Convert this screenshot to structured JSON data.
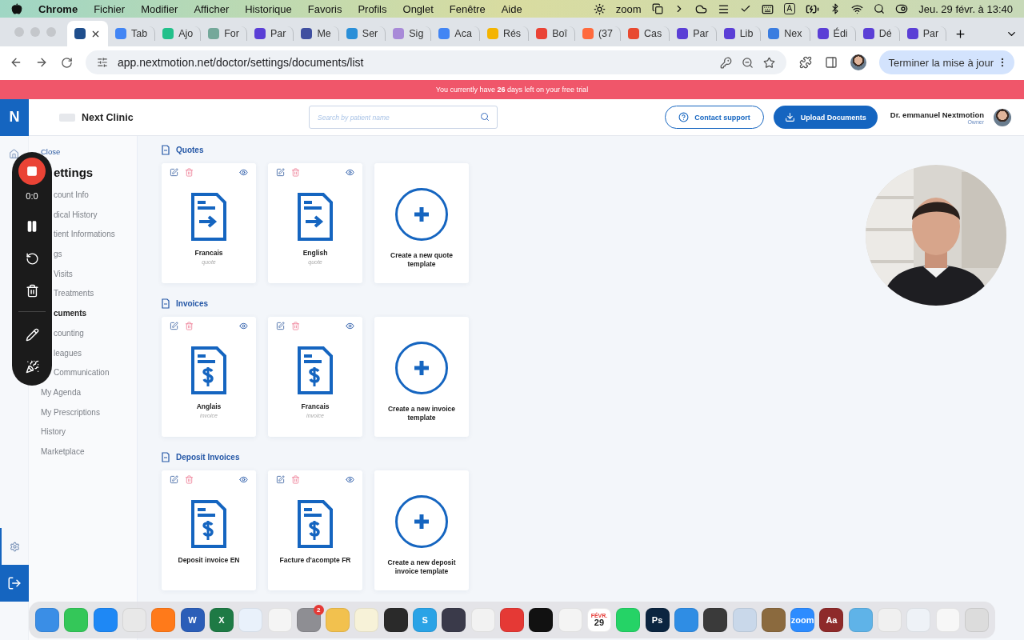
{
  "menubar": {
    "app": "Chrome",
    "menus": [
      "Fichier",
      "Modifier",
      "Afficher",
      "Historique",
      "Favoris",
      "Profils",
      "Onglet",
      "Fenêtre",
      "Aide"
    ],
    "zoom_label": "zoom",
    "input_source": "A",
    "clock": "Jeu. 29 févr. à 13:40"
  },
  "tabs": [
    {
      "selected": true,
      "color": "#1f4e8c"
    },
    {
      "label": "Tab",
      "selected": false,
      "color": "#4285f4"
    },
    {
      "label": "Ajo",
      "selected": false,
      "color": "#22c08a"
    },
    {
      "label": "For",
      "selected": false,
      "color": "#74a89a"
    },
    {
      "label": "Par",
      "selected": false,
      "color": "#5b3fd6"
    },
    {
      "label": "Me",
      "selected": false,
      "color": "#3f4fa0"
    },
    {
      "label": "Ser",
      "selected": false,
      "color": "#2a8fd8"
    },
    {
      "label": "Sig",
      "selected": false,
      "color": "#a88ad8"
    },
    {
      "label": "Aca",
      "selected": false,
      "color": "#4285f4"
    },
    {
      "label": "Rés",
      "selected": false,
      "color": "#f4b400"
    },
    {
      "label": "Boî",
      "selected": false,
      "color": "#ea4335"
    },
    {
      "label": "(37",
      "selected": false,
      "color": "#ff6a3d"
    },
    {
      "label": "Cas",
      "selected": false,
      "color": "#e8492f"
    },
    {
      "label": "Par",
      "selected": false,
      "color": "#5b3fd6"
    },
    {
      "label": "Lib",
      "selected": false,
      "color": "#5b3fd6"
    },
    {
      "label": "Nex",
      "selected": false,
      "color": "#3b7de0"
    },
    {
      "label": "Édi",
      "selected": false,
      "color": "#5b3fd6"
    },
    {
      "label": "Dé",
      "selected": false,
      "color": "#5b3fd6"
    },
    {
      "label": "Par",
      "selected": false,
      "color": "#5b3fd6"
    }
  ],
  "address_bar": {
    "url": "app.nextmotion.net/doctor/settings/documents/list",
    "update_button": "Terminer la mise à jour"
  },
  "banner": {
    "text": "You currently have **26** days left on your free trial"
  },
  "header": {
    "logo": "N",
    "clinic": "Next Clinic",
    "search": {
      "placeholder": "Search by patient name"
    },
    "contact_button": "Contact support",
    "upload_button": "Upload Documents",
    "user": {
      "name": "Dr. emmanuel Nextmotion",
      "role": "Owner"
    }
  },
  "sidebar": {
    "close": "Close",
    "title": "ettings",
    "items": [
      {
        "label": "count Info",
        "selected": false,
        "kind": "partial"
      },
      {
        "label": "dical History",
        "selected": false,
        "kind": "partial"
      },
      {
        "label": "tient Informations",
        "selected": false,
        "kind": "partial"
      },
      {
        "label": "gs",
        "selected": false,
        "kind": "partial"
      },
      {
        "label": "Visits",
        "selected": false,
        "kind": "partial"
      },
      {
        "label": "Treatments",
        "selected": false,
        "kind": "partial"
      },
      {
        "label": "cuments",
        "selected": true,
        "kind": "partial"
      },
      {
        "label": "counting",
        "selected": false,
        "kind": "partial"
      },
      {
        "label": "leagues",
        "selected": false,
        "kind": "partial"
      },
      {
        "label": "Communication",
        "selected": false,
        "kind": "partial"
      },
      {
        "label": "My Agenda",
        "selected": false
      },
      {
        "label": "My Prescriptions",
        "selected": false
      },
      {
        "label": "History",
        "selected": false
      },
      {
        "label": "Marketplace",
        "selected": false
      }
    ]
  },
  "sections": [
    {
      "title": "Quotes",
      "kind": "quote",
      "templates": [
        {
          "name": "Francais",
          "type": "quote"
        },
        {
          "name": "English",
          "type": "quote"
        }
      ],
      "create": "Create a new quote template"
    },
    {
      "title": "Invoices",
      "kind": "invoice",
      "templates": [
        {
          "name": "Anglais",
          "type": "invoice"
        },
        {
          "name": "Francais",
          "type": "invoice"
        }
      ],
      "create": "Create a new invoice template"
    },
    {
      "title": "Deposit Invoices",
      "kind": "invoice",
      "templates": [
        {
          "name": "Deposit invoice EN"
        },
        {
          "name": "Facture d'acompte FR"
        }
      ],
      "create": "Create a new deposit invoice template"
    }
  ],
  "recorder": {
    "timer": "0:0"
  },
  "dock": {
    "items": [
      {
        "color": "#3a8ee6"
      },
      {
        "color": "#34c759"
      },
      {
        "color": "#1e88f5"
      },
      {
        "color": "#e8e8e8"
      },
      {
        "color": "#ff7a1a"
      },
      {
        "color": "#2b5eb8",
        "label": "W"
      },
      {
        "color": "#1e7a45",
        "label": "X"
      },
      {
        "color": "#e9f1fb"
      },
      {
        "color": "#f5f5f5"
      },
      {
        "color": "#8e8e93",
        "badge": "2"
      },
      {
        "color": "#f2c14e"
      },
      {
        "color": "#f7f2d8"
      },
      {
        "color": "#2a2a2a"
      },
      {
        "color": "#2aa3e6",
        "label": "S"
      },
      {
        "color": "#3a3a4a"
      },
      {
        "color": "#f2f2f2"
      },
      {
        "color": "#e53935"
      },
      {
        "color": "#111111"
      },
      {
        "color": "#f4f4f4"
      },
      {
        "color": "#ffffff",
        "label": "29",
        "caption": "FÉVR."
      },
      {
        "color": "#25d366"
      },
      {
        "color": "#0b2540",
        "label": "Ps"
      },
      {
        "color": "#2f8de4"
      },
      {
        "color": "#3a3a3a"
      },
      {
        "color": "#c9d8ea"
      },
      {
        "color": "#8b6a3e"
      },
      {
        "color": "#2d8cff",
        "label": "zoom"
      },
      {
        "color": "#8e2a2a",
        "label": "Aa"
      },
      {
        "color": "#5fb3e8"
      },
      {
        "color": "#f0f0f0"
      },
      {
        "color": "#eef2f7"
      },
      {
        "color": "#f7f7f7"
      },
      {
        "color": "#dcdcdc"
      }
    ]
  }
}
